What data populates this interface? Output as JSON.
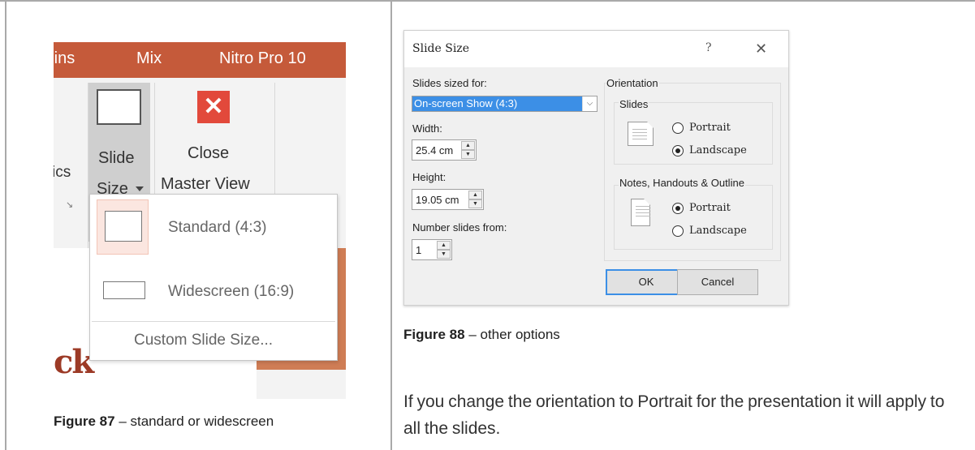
{
  "ribbon": {
    "tabs": [
      "-ins",
      "Mix",
      "Nitro Pro 10"
    ],
    "partial_label": "ics",
    "slide_size_line1": "Slide",
    "slide_size_line2": "Size",
    "close_line1": "Close",
    "close_line2": "Master View",
    "close_icon_glyph": "✕",
    "ghost_text": "ck"
  },
  "slide_size_menu": {
    "standard": "Standard (4:3)",
    "widescreen": "Widescreen (16:9)",
    "custom": "Custom Slide Size..."
  },
  "captions": {
    "fig87_number": "Figure 87",
    "fig87_text": " – standard or widescreen",
    "fig88_number": "Figure 88",
    "fig88_text": " – other options"
  },
  "dialog": {
    "title": "Slide Size",
    "help": "?",
    "close": "✕",
    "slides_sized_for_label": "Slides sized for:",
    "slides_sized_for_value": "On-screen Show (4:3)",
    "width_label": "Width:",
    "width_value": "25.4 cm",
    "height_label": "Height:",
    "height_value": "19.05 cm",
    "number_from_label": "Number slides from:",
    "number_from_value": "1",
    "orientation_label": "Orientation",
    "slides_group_label": "Slides",
    "slides_portrait": "Portrait",
    "slides_landscape": "Landscape",
    "notes_group_label": "Notes, Handouts & Outline",
    "notes_portrait": "Portrait",
    "notes_landscape": "Landscape",
    "ok": "OK",
    "cancel": "Cancel",
    "slides_orientation_selected": "Landscape",
    "notes_orientation_selected": "Portrait"
  },
  "body": {
    "paragraph": "If you change the orientation to Portrait for the presentation it will apply to all the slides."
  },
  "colors": {
    "ribbon_accent": "#c55a3a",
    "close_icon": "#e2493b",
    "selection": "#3c8fe6"
  }
}
